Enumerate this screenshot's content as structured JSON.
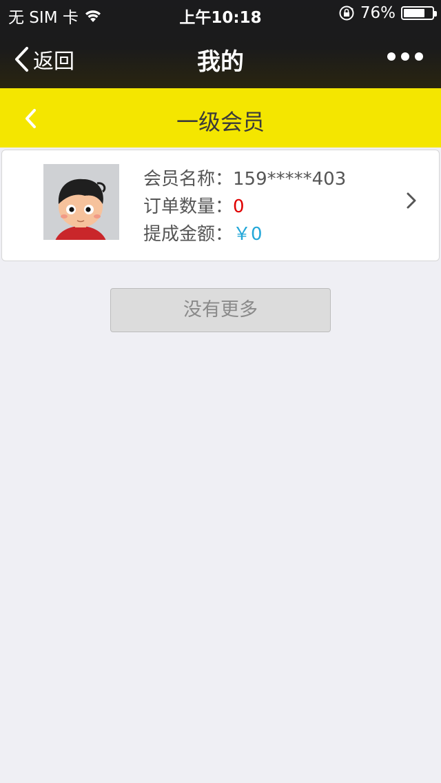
{
  "status_bar": {
    "carrier": "无 SIM 卡",
    "time": "上午10:18",
    "battery_percent": "76%",
    "battery_level": 0.76
  },
  "nav_bar": {
    "back_label": "返回",
    "title": "我的",
    "more_icon": "more-dots-icon"
  },
  "page_header": {
    "title": "一级会员",
    "back_icon": "chevron-left-icon"
  },
  "member": {
    "name_label": "会员名称：",
    "name_value": "159*****403",
    "orders_label": "订单数量：",
    "orders_value": "0",
    "commission_label": "提成金额：",
    "commission_value": "￥0"
  },
  "footer_button": {
    "label": "没有更多"
  },
  "colors": {
    "accent_yellow": "#f4e600",
    "order_count_red": "#e00000",
    "commission_blue": "#23a7d8",
    "background": "#efeff4"
  }
}
